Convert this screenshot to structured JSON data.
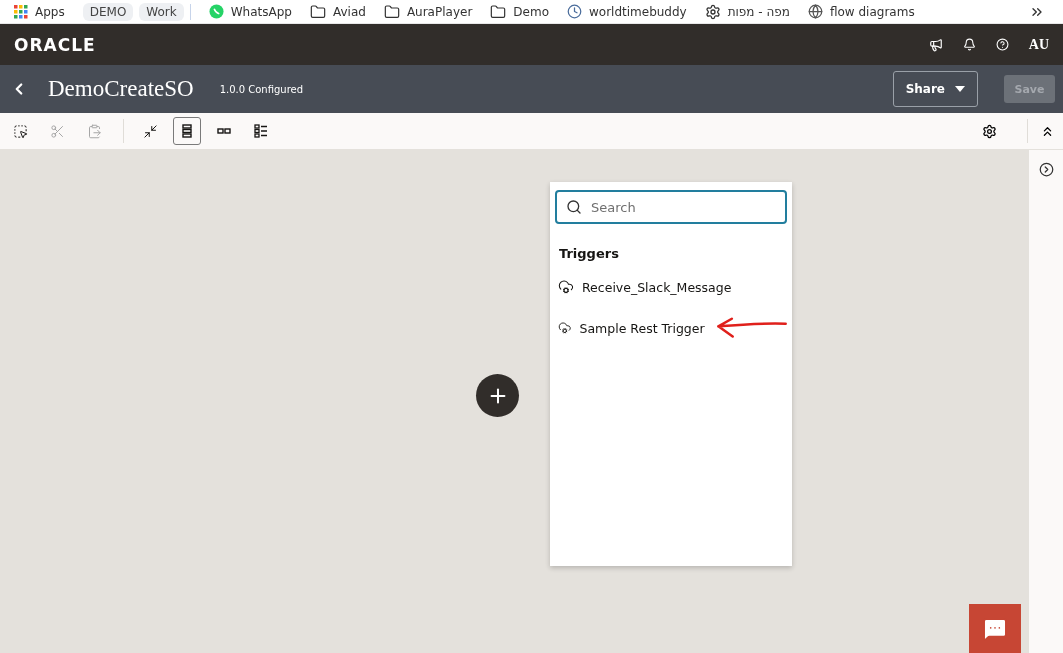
{
  "bookmarks": [
    {
      "kind": "apps",
      "label": "Apps"
    },
    {
      "kind": "chip",
      "label": "DEMO"
    },
    {
      "kind": "chip",
      "label": "Work"
    },
    {
      "kind": "divider"
    },
    {
      "kind": "whatsapp",
      "label": "WhatsApp"
    },
    {
      "kind": "folder",
      "label": "Aviad"
    },
    {
      "kind": "folder",
      "label": "AuraPlayer"
    },
    {
      "kind": "folder",
      "label": "Demo"
    },
    {
      "kind": "clock",
      "label": "worldtimebuddy"
    },
    {
      "kind": "gear",
      "label": "מפה - מפות"
    },
    {
      "kind": "globe",
      "label": "flow diagrams"
    }
  ],
  "header": {
    "logo": "ORACLE",
    "user": "AU"
  },
  "title_bar": {
    "title": "DemoCreateSO",
    "version": "1.0.0 Configured",
    "share": "Share",
    "save": {
      "label": "Save",
      "disabled": true
    }
  },
  "toolbar": [
    {
      "kind": "select",
      "disabled": false,
      "selected": false
    },
    {
      "kind": "cut",
      "disabled": true,
      "selected": false
    },
    {
      "kind": "paste",
      "disabled": true,
      "selected": false
    },
    {
      "kind": "divider"
    },
    {
      "kind": "collapse",
      "disabled": false,
      "selected": false
    },
    {
      "kind": "vertical",
      "disabled": false,
      "selected": true
    },
    {
      "kind": "horizontal",
      "disabled": false,
      "selected": false
    },
    {
      "kind": "list",
      "disabled": false,
      "selected": false
    }
  ],
  "trigger_panel": {
    "search": {
      "placeholder": "Search"
    },
    "section": "Triggers",
    "items": [
      {
        "label": "Receive_Slack_Message",
        "highlighted": false
      },
      {
        "label": "Sample Rest Trigger",
        "highlighted": true
      }
    ]
  }
}
